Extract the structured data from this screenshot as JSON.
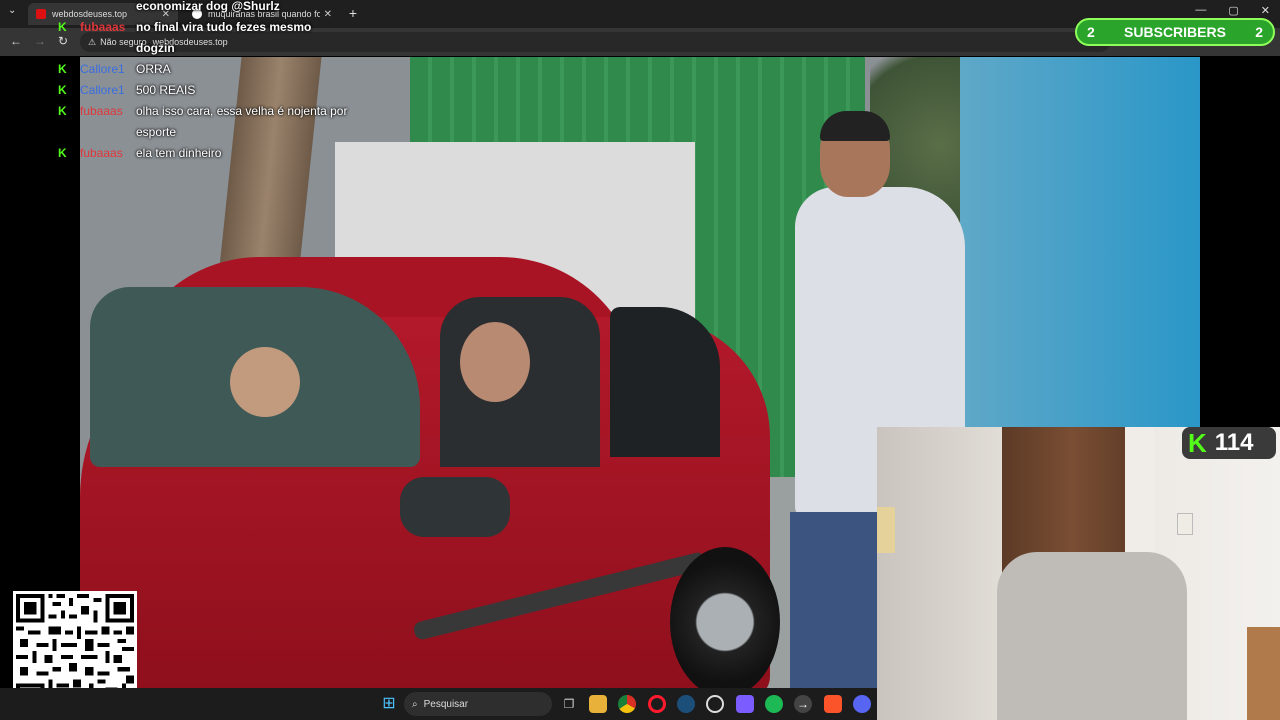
{
  "browser": {
    "tabs": [
      {
        "label": "webdosdeuses.top",
        "active": true
      },
      {
        "label": "muquiranas brasil quando foi g",
        "active": false
      }
    ],
    "new_tab": "+",
    "address": {
      "security": "Não seguro",
      "url": "webdosdeuses.top"
    }
  },
  "chat": {
    "messages": [
      {
        "user": "",
        "text": "economizar dog @Shurlz",
        "user_color": "#e0e0e0"
      },
      {
        "user": "fubaaas",
        "text": "no final vira tudo fezes mesmo dogzin",
        "user_color": "#e0363a"
      },
      {
        "user": "Callore1",
        "text": "ORRA",
        "user_color": "#3a6ee0"
      },
      {
        "user": "Callore1",
        "text": "500 REAIS",
        "user_color": "#3a6ee0"
      },
      {
        "user": "fubaaas",
        "text": "olha isso cara, essa velha é nojenta por esporte",
        "user_color": "#e0363a"
      },
      {
        "user": "fubaaas",
        "text": "ela tem dinheiro",
        "user_color": "#e0363a"
      }
    ],
    "badge_icon": "kick-icon",
    "badge_glyph": "K",
    "badge_color": "#53fc18"
  },
  "subscribers": {
    "left_count": "2",
    "label": "SUBSCRIBERS",
    "right_count": "2"
  },
  "viewers": {
    "logo": "K",
    "count": "114"
  },
  "taskbar": {
    "search_placeholder": "Pesquisar"
  },
  "colors": {
    "kick_green": "#53fc18",
    "subs_green": "#2aa42a"
  }
}
